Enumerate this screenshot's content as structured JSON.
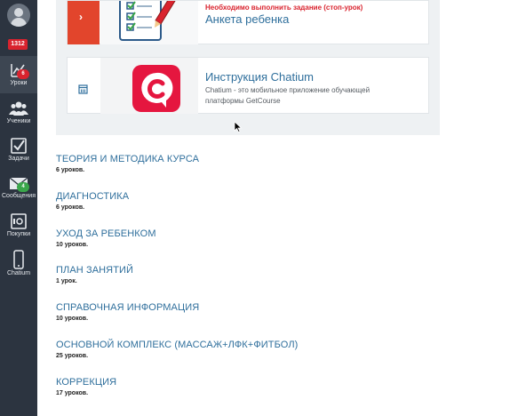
{
  "sidebar": {
    "total_badge": "1312",
    "items": [
      {
        "label": "Уроки",
        "icon": "chart-line-icon",
        "badge": "6",
        "badge_color": "#d9232e",
        "active": true
      },
      {
        "label": "Ученики",
        "icon": "users-icon"
      },
      {
        "label": "Задачи",
        "icon": "checkbox-icon"
      },
      {
        "label": "Сообщения",
        "icon": "envelope-icon",
        "badge": "4",
        "badge_color": "#3aa64b"
      },
      {
        "label": "Покупки",
        "icon": "safe-icon"
      },
      {
        "label": "Chatium",
        "icon": "phone-icon"
      }
    ]
  },
  "cards": [
    {
      "warning": "Необходимо выполнить задание (стоп-урок)",
      "title": "Анкета ребенка",
      "thumb_icon": "checklist-pencil-icon"
    },
    {
      "title": "Инструкция Chatium",
      "description": "Chatium - это мобильное приложение обучающей платформы GetCourse",
      "thumb_icon": "chatium-logo-icon"
    }
  ],
  "sections": [
    {
      "title": "ТЕОРИЯ И МЕТОДИКА КУРСА",
      "count": "6 уроков."
    },
    {
      "title": "ДИАГНОСТИКА",
      "count": "6 уроков."
    },
    {
      "title": "УХОД ЗА РЕБЕНКОМ",
      "count": "10 уроков."
    },
    {
      "title": "ПЛАН ЗАНЯТИЙ",
      "count": "1 урок."
    },
    {
      "title": "СПРАВОЧНАЯ ИНФОРМАЦИЯ",
      "count": "10 уроков."
    },
    {
      "title": "ОСНОВНОЙ КОМПЛЕКС (МАССАЖ+ЛФК+ФИТБОЛ)",
      "count": "25 уроков."
    },
    {
      "title": "КОРРЕКЦИЯ",
      "count": "17 уроков."
    }
  ],
  "colors": {
    "sidebar_bg": "#2c3440",
    "link": "#2f6f9c",
    "warning": "#d9232e",
    "accent_red": "#e2452c",
    "chatium": "#e5163f"
  }
}
